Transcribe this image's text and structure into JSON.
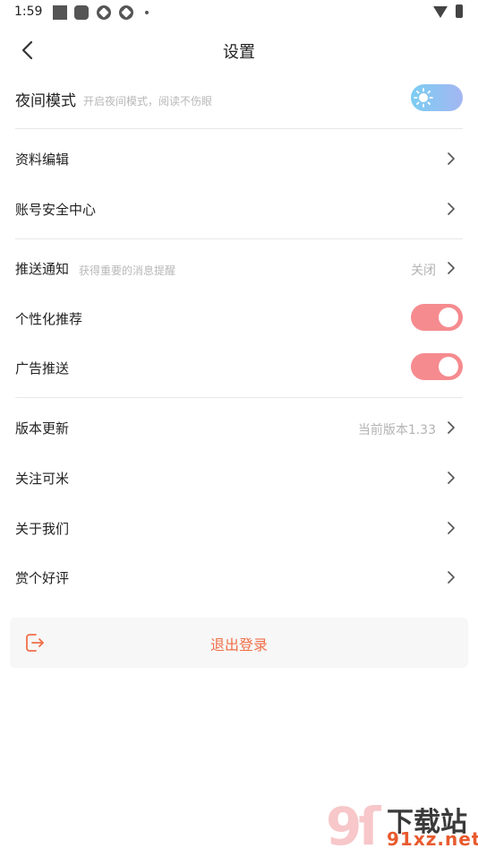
{
  "status_bar": {
    "time": "1:59"
  },
  "header": {
    "title": "设置"
  },
  "night_mode": {
    "label": "夜间模式",
    "hint": "开启夜间模式，阅读不伤眼",
    "enabled": false
  },
  "profile_edit": {
    "label": "资料编辑"
  },
  "account_security": {
    "label": "账号安全中心"
  },
  "push": {
    "label": "推送通知",
    "hint": "获得重要的消息提醒",
    "value": "关闭"
  },
  "personalized": {
    "label": "个性化推荐",
    "enabled": true
  },
  "ads": {
    "label": "广告推送",
    "enabled": true
  },
  "version": {
    "label": "版本更新",
    "value": "当前版本1.33"
  },
  "follow": {
    "label": "关注可米"
  },
  "about": {
    "label": "关于我们"
  },
  "rate": {
    "label": "赏个好评"
  },
  "logout": {
    "label": "退出登录"
  },
  "watermark": {
    "top": "下载站",
    "bottom": "91xz.net"
  },
  "colors": {
    "accent": "#f06f48",
    "toggle_on": "#f58b8f",
    "night_toggle": "#8fc4f2"
  }
}
